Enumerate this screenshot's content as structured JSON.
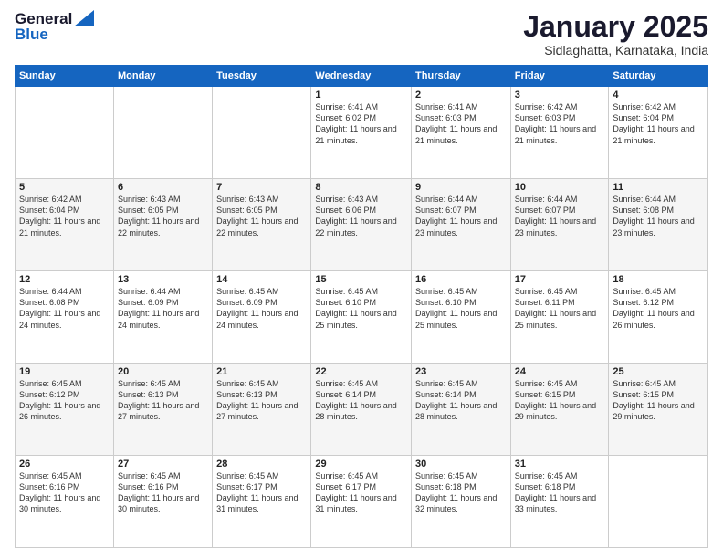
{
  "logo": {
    "line1": "General",
    "line2": "Blue"
  },
  "title": "January 2025",
  "subtitle": "Sidlaghatta, Karnataka, India",
  "weekdays": [
    "Sunday",
    "Monday",
    "Tuesday",
    "Wednesday",
    "Thursday",
    "Friday",
    "Saturday"
  ],
  "weeks": [
    [
      {
        "day": "",
        "sunrise": "",
        "sunset": "",
        "daylight": ""
      },
      {
        "day": "",
        "sunrise": "",
        "sunset": "",
        "daylight": ""
      },
      {
        "day": "",
        "sunrise": "",
        "sunset": "",
        "daylight": ""
      },
      {
        "day": "1",
        "sunrise": "Sunrise: 6:41 AM",
        "sunset": "Sunset: 6:02 PM",
        "daylight": "Daylight: 11 hours and 21 minutes."
      },
      {
        "day": "2",
        "sunrise": "Sunrise: 6:41 AM",
        "sunset": "Sunset: 6:03 PM",
        "daylight": "Daylight: 11 hours and 21 minutes."
      },
      {
        "day": "3",
        "sunrise": "Sunrise: 6:42 AM",
        "sunset": "Sunset: 6:03 PM",
        "daylight": "Daylight: 11 hours and 21 minutes."
      },
      {
        "day": "4",
        "sunrise": "Sunrise: 6:42 AM",
        "sunset": "Sunset: 6:04 PM",
        "daylight": "Daylight: 11 hours and 21 minutes."
      }
    ],
    [
      {
        "day": "5",
        "sunrise": "Sunrise: 6:42 AM",
        "sunset": "Sunset: 6:04 PM",
        "daylight": "Daylight: 11 hours and 21 minutes."
      },
      {
        "day": "6",
        "sunrise": "Sunrise: 6:43 AM",
        "sunset": "Sunset: 6:05 PM",
        "daylight": "Daylight: 11 hours and 22 minutes."
      },
      {
        "day": "7",
        "sunrise": "Sunrise: 6:43 AM",
        "sunset": "Sunset: 6:05 PM",
        "daylight": "Daylight: 11 hours and 22 minutes."
      },
      {
        "day": "8",
        "sunrise": "Sunrise: 6:43 AM",
        "sunset": "Sunset: 6:06 PM",
        "daylight": "Daylight: 11 hours and 22 minutes."
      },
      {
        "day": "9",
        "sunrise": "Sunrise: 6:44 AM",
        "sunset": "Sunset: 6:07 PM",
        "daylight": "Daylight: 11 hours and 23 minutes."
      },
      {
        "day": "10",
        "sunrise": "Sunrise: 6:44 AM",
        "sunset": "Sunset: 6:07 PM",
        "daylight": "Daylight: 11 hours and 23 minutes."
      },
      {
        "day": "11",
        "sunrise": "Sunrise: 6:44 AM",
        "sunset": "Sunset: 6:08 PM",
        "daylight": "Daylight: 11 hours and 23 minutes."
      }
    ],
    [
      {
        "day": "12",
        "sunrise": "Sunrise: 6:44 AM",
        "sunset": "Sunset: 6:08 PM",
        "daylight": "Daylight: 11 hours and 24 minutes."
      },
      {
        "day": "13",
        "sunrise": "Sunrise: 6:44 AM",
        "sunset": "Sunset: 6:09 PM",
        "daylight": "Daylight: 11 hours and 24 minutes."
      },
      {
        "day": "14",
        "sunrise": "Sunrise: 6:45 AM",
        "sunset": "Sunset: 6:09 PM",
        "daylight": "Daylight: 11 hours and 24 minutes."
      },
      {
        "day": "15",
        "sunrise": "Sunrise: 6:45 AM",
        "sunset": "Sunset: 6:10 PM",
        "daylight": "Daylight: 11 hours and 25 minutes."
      },
      {
        "day": "16",
        "sunrise": "Sunrise: 6:45 AM",
        "sunset": "Sunset: 6:10 PM",
        "daylight": "Daylight: 11 hours and 25 minutes."
      },
      {
        "day": "17",
        "sunrise": "Sunrise: 6:45 AM",
        "sunset": "Sunset: 6:11 PM",
        "daylight": "Daylight: 11 hours and 25 minutes."
      },
      {
        "day": "18",
        "sunrise": "Sunrise: 6:45 AM",
        "sunset": "Sunset: 6:12 PM",
        "daylight": "Daylight: 11 hours and 26 minutes."
      }
    ],
    [
      {
        "day": "19",
        "sunrise": "Sunrise: 6:45 AM",
        "sunset": "Sunset: 6:12 PM",
        "daylight": "Daylight: 11 hours and 26 minutes."
      },
      {
        "day": "20",
        "sunrise": "Sunrise: 6:45 AM",
        "sunset": "Sunset: 6:13 PM",
        "daylight": "Daylight: 11 hours and 27 minutes."
      },
      {
        "day": "21",
        "sunrise": "Sunrise: 6:45 AM",
        "sunset": "Sunset: 6:13 PM",
        "daylight": "Daylight: 11 hours and 27 minutes."
      },
      {
        "day": "22",
        "sunrise": "Sunrise: 6:45 AM",
        "sunset": "Sunset: 6:14 PM",
        "daylight": "Daylight: 11 hours and 28 minutes."
      },
      {
        "day": "23",
        "sunrise": "Sunrise: 6:45 AM",
        "sunset": "Sunset: 6:14 PM",
        "daylight": "Daylight: 11 hours and 28 minutes."
      },
      {
        "day": "24",
        "sunrise": "Sunrise: 6:45 AM",
        "sunset": "Sunset: 6:15 PM",
        "daylight": "Daylight: 11 hours and 29 minutes."
      },
      {
        "day": "25",
        "sunrise": "Sunrise: 6:45 AM",
        "sunset": "Sunset: 6:15 PM",
        "daylight": "Daylight: 11 hours and 29 minutes."
      }
    ],
    [
      {
        "day": "26",
        "sunrise": "Sunrise: 6:45 AM",
        "sunset": "Sunset: 6:16 PM",
        "daylight": "Daylight: 11 hours and 30 minutes."
      },
      {
        "day": "27",
        "sunrise": "Sunrise: 6:45 AM",
        "sunset": "Sunset: 6:16 PM",
        "daylight": "Daylight: 11 hours and 30 minutes."
      },
      {
        "day": "28",
        "sunrise": "Sunrise: 6:45 AM",
        "sunset": "Sunset: 6:17 PM",
        "daylight": "Daylight: 11 hours and 31 minutes."
      },
      {
        "day": "29",
        "sunrise": "Sunrise: 6:45 AM",
        "sunset": "Sunset: 6:17 PM",
        "daylight": "Daylight: 11 hours and 31 minutes."
      },
      {
        "day": "30",
        "sunrise": "Sunrise: 6:45 AM",
        "sunset": "Sunset: 6:18 PM",
        "daylight": "Daylight: 11 hours and 32 minutes."
      },
      {
        "day": "31",
        "sunrise": "Sunrise: 6:45 AM",
        "sunset": "Sunset: 6:18 PM",
        "daylight": "Daylight: 11 hours and 33 minutes."
      },
      {
        "day": "",
        "sunrise": "",
        "sunset": "",
        "daylight": ""
      }
    ]
  ]
}
